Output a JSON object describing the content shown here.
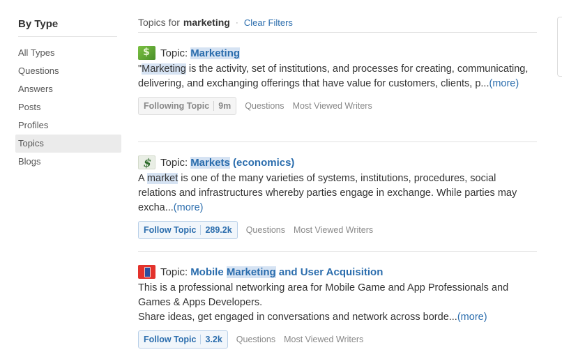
{
  "sidebar": {
    "heading": "By Type",
    "items": [
      {
        "label": "All Types",
        "active": false
      },
      {
        "label": "Questions",
        "active": false
      },
      {
        "label": "Answers",
        "active": false
      },
      {
        "label": "Posts",
        "active": false
      },
      {
        "label": "Profiles",
        "active": false
      },
      {
        "label": "Topics",
        "active": true
      },
      {
        "label": "Blogs",
        "active": false
      }
    ]
  },
  "filter": {
    "prefix": "Topics for",
    "query": "marketing",
    "separator": "·",
    "clear_label": "Clear Filters"
  },
  "results": [
    {
      "icon": "marketing-topic-thumbnail",
      "prefix": "Topic:",
      "title_highlight": "Marketing",
      "title_rest": "",
      "desc_lead": "\"",
      "desc_highlight": "Marketing",
      "desc_rest": " is the activity, set of institutions, and processes for  creating, communicating, delivering, and exchanging offerings that have  value for customers, clients, p...",
      "more": "(more)",
      "follow_label": "Following Topic",
      "follow_count": "9m",
      "following": true,
      "questions_label": "Questions",
      "writers_label": "Most Viewed Writers"
    },
    {
      "icon": "markets-topic-thumbnail",
      "prefix": "Topic:",
      "title_highlight": "Markets",
      "title_rest": " (economics)",
      "desc_lead": "A ",
      "desc_highlight": "market",
      "desc_rest": " is one of the many varieties of systems, institutions, procedures, social relations and infrastructures whereby parties engage in exchange. While parties may excha...",
      "more": "(more)",
      "follow_label": "Follow Topic",
      "follow_count": "289.2k",
      "following": false,
      "questions_label": "Questions",
      "writers_label": "Most Viewed Writers"
    },
    {
      "icon": "mobile-marketing-topic-thumbnail",
      "prefix": "Topic:",
      "title_pre": "Mobile ",
      "title_highlight": "Marketing",
      "title_rest": " and User Acquisition",
      "desc_line1": "This is a professional networking area for Mobile Game and App Professionals and Games & Apps Developers.",
      "desc_line2": "Share ideas, get engaged in conversations and network across borde...",
      "more": "(more)",
      "follow_label": "Follow Topic",
      "follow_count": "3.2k",
      "following": false,
      "questions_label": "Questions",
      "writers_label": "Most Viewed Writers"
    }
  ]
}
